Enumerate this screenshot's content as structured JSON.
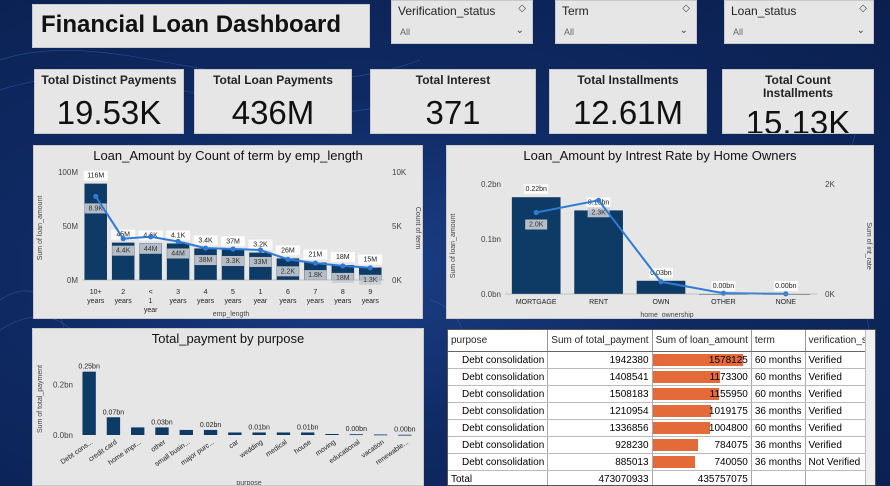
{
  "title": "Financial Loan  Dashboard",
  "filters": [
    {
      "label": "Verification_status",
      "value": "All"
    },
    {
      "label": "Term",
      "value": "All"
    },
    {
      "label": "Loan_status",
      "value": "All"
    }
  ],
  "kpis": [
    {
      "label": "Total Distinct Payments",
      "value": "19.53K"
    },
    {
      "label": "Total Loan Payments",
      "value": "436M"
    },
    {
      "label": "Total Interest",
      "value": "371"
    },
    {
      "label": "Total Installments",
      "value": "12.61M"
    },
    {
      "label": "Total Count Installments",
      "value": "15.13K"
    }
  ],
  "chart_data": [
    {
      "type": "bar",
      "title": "Loan_Amount by Count of term by emp_length",
      "xlabel": "emp_length",
      "ylabel": "Sum of loan_amount",
      "y2label": "Count of term",
      "categories": [
        "10+ years",
        "2 years",
        "< 1 year",
        "3 years",
        "4 years",
        "5 years",
        "1 year",
        "6 years",
        "7 years",
        "8 years",
        "9 years"
      ],
      "yticks": [
        "100M",
        "50M",
        "0M"
      ],
      "y2ticks": [
        "10K",
        "5K",
        "0K"
      ],
      "ylim": [
        0,
        130000000
      ],
      "y2lim": [
        0,
        11500
      ],
      "series": [
        {
          "values": [
            116000000,
            45000000,
            44000000,
            44000000,
            38000000,
            37000000,
            33000000,
            26000000,
            21000000,
            18000000,
            15000000
          ],
          "labels": [
            "116M",
            "45M",
            "4.6K",
            "4.1K",
            "3.4K",
            "37M",
            "3.2K",
            "26M",
            "21M",
            "18M",
            "15M"
          ]
        },
        {
          "values": [
            8900,
            4400,
            4600,
            4100,
            3400,
            3300,
            3200,
            2200,
            1800,
            1500,
            1300
          ],
          "labels": [
            "8.9K",
            "4.4K",
            "44M",
            "44M",
            "38M",
            "3.3K",
            "33M",
            "2.2K",
            "1.8K",
            "18M",
            "1.3K"
          ]
        }
      ]
    },
    {
      "type": "bar",
      "title": "Loan_Amount by Intrest Rate by Home Owners",
      "xlabel": "home_ownership",
      "ylabel": "Sum of loan_amount",
      "y2label": "Sum of int_rate",
      "categories": [
        "MORTGAGE",
        "RENT",
        "OWN",
        "OTHER",
        "NONE"
      ],
      "yticks": [
        "0.2bn",
        "0.1bn",
        "0.0bn"
      ],
      "y2ticks": [
        "2K",
        "0K"
      ],
      "ylim": [
        0,
        0.25
      ],
      "y2lim": [
        0,
        2700
      ],
      "series": [
        {
          "values": [
            0.22,
            0.19,
            0.03,
            0.0,
            0.0
          ],
          "labels": [
            "0.22bn",
            "0.19bn",
            "0.03bn",
            "0.00bn",
            "0.00bn"
          ]
        },
        {
          "values": [
            2000,
            2300,
            300,
            20,
            5
          ],
          "labels": [
            "2.0K",
            "2.3K",
            "",
            "",
            ""
          ]
        }
      ]
    },
    {
      "type": "bar",
      "title": "Total_payment by purpose",
      "xlabel": "purpose",
      "ylabel": "Sum of total_payment",
      "categories": [
        "Debt cons...",
        "credit card",
        "home impr...",
        "other",
        "small busin...",
        "major purc...",
        "car",
        "wedding",
        "medical",
        "house",
        "moving",
        "educational",
        "vacation",
        "renewable..."
      ],
      "yticks": [
        "0.2bn",
        "0.0bn"
      ],
      "ylim": [
        0,
        0.3
      ],
      "values": [
        0.25,
        0.07,
        0.03,
        0.03,
        0.02,
        0.02,
        0.01,
        0.01,
        0.01,
        0.01,
        0.004,
        0.003,
        0.002,
        0.001
      ],
      "labels": [
        "0.25bn",
        "0.07bn",
        "",
        "0.03bn",
        "",
        "0.02bn",
        "",
        "0.01bn",
        "",
        "0.01bn",
        "",
        "0.00bn",
        "",
        "0.00bn"
      ]
    }
  ],
  "table": {
    "columns": [
      "purpose",
      "Sum of total_payment",
      "Sum of loan_amount",
      "term",
      "verification_status"
    ],
    "rows": [
      {
        "purpose": "Debt consolidation",
        "total_payment": "1942380",
        "loan_amount": "1578125",
        "loan_frac": 1.0,
        "term": "60 months",
        "verification": "Verified"
      },
      {
        "purpose": "Debt consolidation",
        "total_payment": "1408541",
        "loan_amount": "1173300",
        "loan_frac": 0.743,
        "term": "60 months",
        "verification": "Verified"
      },
      {
        "purpose": "Debt consolidation",
        "total_payment": "1508183",
        "loan_amount": "1155950",
        "loan_frac": 0.732,
        "term": "60 months",
        "verification": "Verified"
      },
      {
        "purpose": "Debt consolidation",
        "total_payment": "1210954",
        "loan_amount": "1019175",
        "loan_frac": 0.646,
        "term": "36 months",
        "verification": "Verified"
      },
      {
        "purpose": "Debt consolidation",
        "total_payment": "1336856",
        "loan_amount": "1004800",
        "loan_frac": 0.637,
        "term": "60 months",
        "verification": "Verified"
      },
      {
        "purpose": "Debt consolidation",
        "total_payment": "928230",
        "loan_amount": "784075",
        "loan_frac": 0.497,
        "term": "36 months",
        "verification": "Verified"
      },
      {
        "purpose": "Debt consolidation",
        "total_payment": "885013",
        "loan_amount": "740050",
        "loan_frac": 0.469,
        "term": "36 months",
        "verification": "Not Verified"
      }
    ],
    "total": {
      "label": "Total",
      "total_payment": "473070933",
      "loan_amount": "435757075"
    }
  },
  "colors": {
    "bar": "#0e3a66",
    "line": "#2f7ad6",
    "table_bar": "#e46b39",
    "panel": "#e6e6e6"
  }
}
